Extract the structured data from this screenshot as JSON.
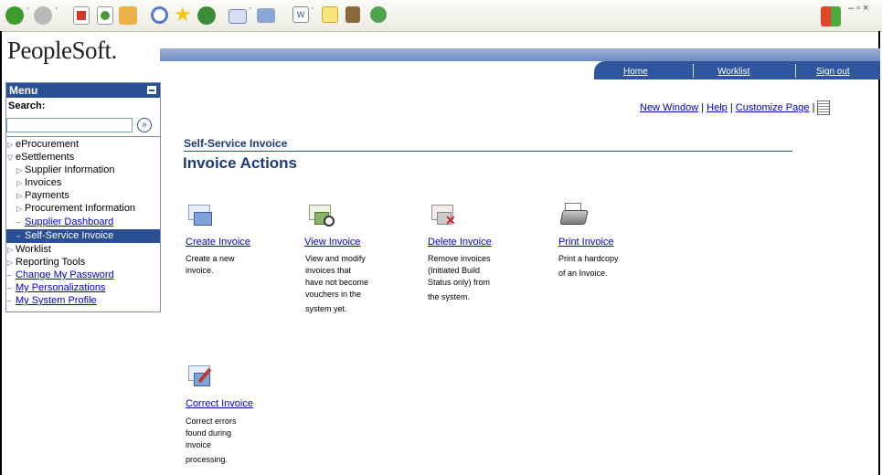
{
  "toolbar": {
    "icons": [
      "back-icon",
      "forward-icon",
      "stop-icon",
      "refresh-icon",
      "home-icon",
      "search-icon",
      "favorites-icon",
      "history-icon",
      "mail-icon",
      "print-icon",
      "word-icon",
      "notes-icon",
      "research-icon",
      "messenger-icon",
      "windows-flag-icon"
    ],
    "window_controls": "– ▫ ×"
  },
  "header": {
    "logo": "PeopleSoft.",
    "nav": {
      "home": "Home",
      "worklist": "Worklist",
      "signout": "Sign out"
    }
  },
  "menu": {
    "title": "Menu",
    "search_label": "Search:",
    "search_value": "",
    "go_glyph": "»",
    "items": [
      {
        "label": "eProcurement"
      },
      {
        "label": "eSettlements"
      },
      {
        "label": "Supplier Information"
      },
      {
        "label": "Invoices"
      },
      {
        "label": "Payments"
      },
      {
        "label": "Procurement Information"
      },
      {
        "label": "Supplier Dashboard"
      },
      {
        "label": "Self-Service Invoice"
      },
      {
        "label": "Worklist"
      },
      {
        "label": "Reporting Tools"
      },
      {
        "label": "Change My Password"
      },
      {
        "label": "My Personalizations"
      },
      {
        "label": "My System Profile"
      }
    ]
  },
  "toplinks": {
    "new_window": "New Window",
    "help": "Help",
    "customize": "Customize Page",
    "sep": "|"
  },
  "main": {
    "section_title": "Self-Service Invoice",
    "page_title": "Invoice Actions",
    "actions": [
      {
        "label": "Create Invoice",
        "desc": [
          "Create a new",
          "invoice."
        ],
        "icon": "create-invoice-icon"
      },
      {
        "label": "View Invoice",
        "desc": [
          "View and modify",
          "invoices that",
          "have not become",
          "vouchers in the",
          "system yet."
        ],
        "icon": "view-invoice-icon"
      },
      {
        "label": "Delete Invoice",
        "desc": [
          "Remove invoices",
          "(Initiated Build",
          "Status only) from",
          "the system."
        ],
        "icon": "delete-invoice-icon"
      },
      {
        "label": "Print Invoice",
        "desc": [
          "Print a hardcopy",
          "of an Invoice."
        ],
        "icon": "printer-icon"
      },
      {
        "label": "Correct Invoice",
        "desc": [
          "Correct errors",
          "found during",
          "invoice",
          "processing."
        ],
        "icon": "correct-invoice-icon"
      }
    ]
  },
  "colors": {
    "nav_blue": "#2f569c",
    "menu_head": "#2a4f93",
    "title_blue": "#1b3c78",
    "link": "#0000cc"
  }
}
